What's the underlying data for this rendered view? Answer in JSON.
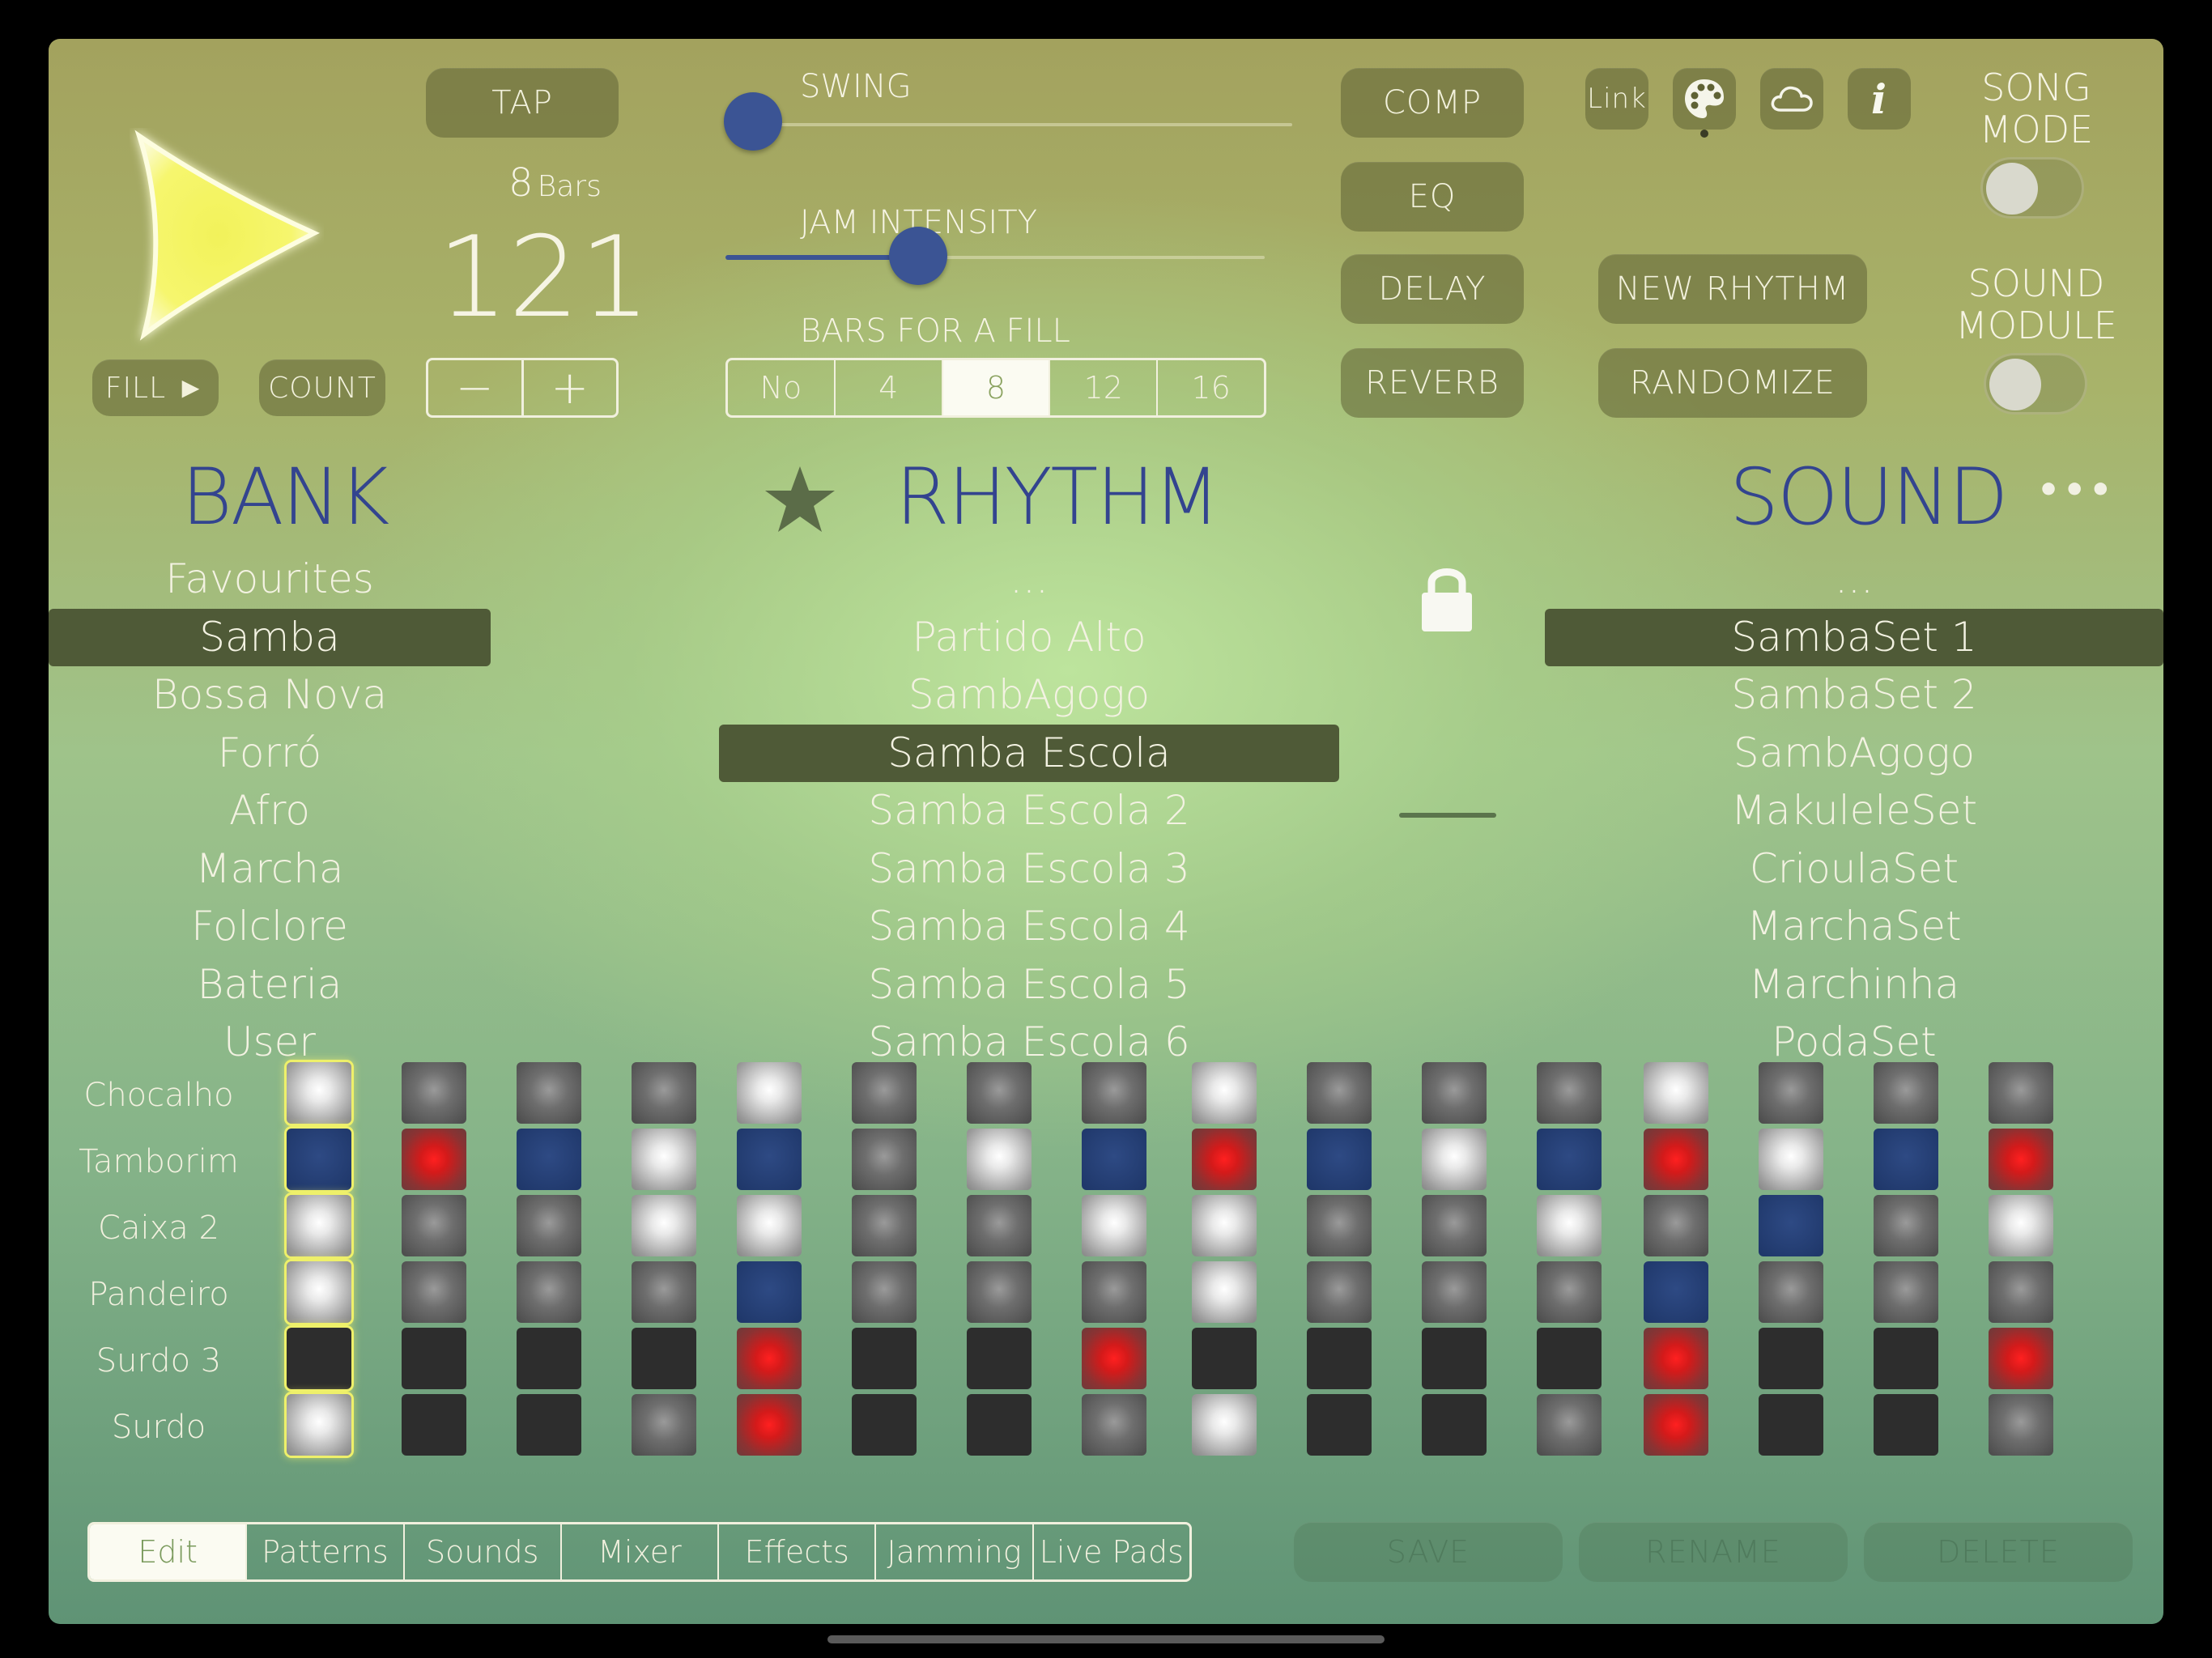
{
  "transport": {
    "tap_label": "TAP",
    "bars_count": "8",
    "bars_label": "Bars",
    "tempo": "121",
    "fill_label": "FILL ►",
    "count_label": "COUNT",
    "minus": "−",
    "plus": "+"
  },
  "sliders": {
    "swing_label": "SWING",
    "swing_value": 0.0,
    "jam_label": "JAM INTENSITY",
    "jam_value": 0.36,
    "bars_fill_label": "BARS FOR A FILL",
    "bars_fill_options": [
      "No",
      "4",
      "8",
      "12",
      "16"
    ],
    "bars_fill_selected": "8"
  },
  "effects": {
    "comp": "COMP",
    "eq": "EQ",
    "delay": "DELAY",
    "reverb": "REVERB"
  },
  "toolbar": {
    "link": "Link",
    "info": "i"
  },
  "actions": {
    "new_rhythm": "NEW RHYTHM",
    "randomize": "RANDOMIZE"
  },
  "modes": {
    "song_mode_line1": "SONG",
    "song_mode_line2": "MODE",
    "song_mode_on": false,
    "sound_module_line1": "SOUND",
    "sound_module_line2": "MODULE",
    "sound_module_on": false
  },
  "bank": {
    "title": "BANK",
    "items": [
      "Favourites",
      "Samba",
      "Bossa Nova",
      "Forró",
      "Afro",
      "Marcha",
      "Folclore",
      "Bateria",
      "User"
    ],
    "selected": "Samba"
  },
  "rhythm": {
    "title": "RHYTHM",
    "items": [
      "...",
      "Partido Alto",
      "SambAgogo",
      "Samba Escola",
      "Samba Escola 2",
      "Samba Escola 3",
      "Samba Escola 4",
      "Samba Escola 5",
      "Samba Escola 6"
    ],
    "selected": "Samba Escola"
  },
  "sound": {
    "title": "SOUND",
    "more": "•••",
    "items": [
      "...",
      "SambaSet 1",
      "SambaSet 2",
      "SambAgogo",
      "MakuleleSet",
      "CrioulaSet",
      "MarchaSet",
      "Marchinha",
      "PodaSet"
    ],
    "selected": "SambaSet 1"
  },
  "sequencer": {
    "tracks": [
      "Chocalho",
      "Tamborim",
      "Caixa 2",
      "Pandeiro",
      "Surdo 3",
      "Surdo"
    ],
    "steps": [
      [
        "light",
        "grey",
        "grey",
        "grey",
        "light",
        "grey",
        "grey",
        "grey",
        "light",
        "grey",
        "grey",
        "grey",
        "light",
        "grey",
        "grey",
        "grey"
      ],
      [
        "blue",
        "red",
        "blue",
        "light",
        "blue",
        "grey",
        "light",
        "blue",
        "red",
        "blue",
        "light",
        "blue",
        "red",
        "light",
        "blue",
        "red"
      ],
      [
        "light",
        "grey",
        "grey",
        "light",
        "light",
        "grey",
        "grey",
        "light",
        "light",
        "grey",
        "grey",
        "light",
        "grey",
        "blue",
        "grey",
        "light"
      ],
      [
        "light",
        "grey",
        "grey",
        "grey",
        "blue",
        "grey",
        "grey",
        "grey",
        "light",
        "grey",
        "grey",
        "grey",
        "blue",
        "grey",
        "grey",
        "grey"
      ],
      [
        "dark",
        "dark",
        "dark",
        "dark",
        "red",
        "dark",
        "dark",
        "red",
        "dark",
        "dark",
        "dark",
        "dark",
        "red",
        "dark",
        "dark",
        "red"
      ],
      [
        "light",
        "dark",
        "dark",
        "grey",
        "red",
        "dark",
        "dark",
        "grey",
        "light",
        "dark",
        "dark",
        "grey",
        "red",
        "dark",
        "dark",
        "grey"
      ]
    ],
    "current_step": 1
  },
  "tabs": {
    "items": [
      "Edit",
      "Patterns",
      "Sounds",
      "Mixer",
      "Effects",
      "Jamming",
      "Live Pads"
    ],
    "selected": "Edit"
  },
  "file_actions": {
    "save": "SAVE",
    "rename": "RENAME",
    "delete": "DELETE"
  },
  "colors": {
    "accent_blue": "#3b5494",
    "title_blue": "#33448f",
    "selection_bg": "#4f5a37",
    "play_yellow": "#f4f46a"
  }
}
